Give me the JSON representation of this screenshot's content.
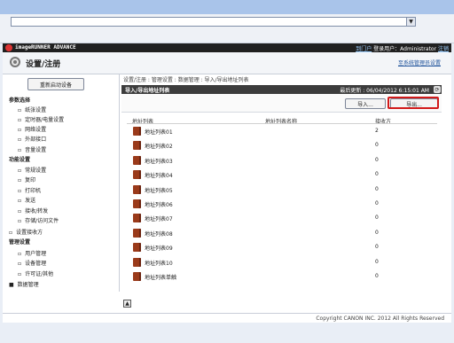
{
  "app": {
    "title": "imageRUNNER ADVANCE",
    "portal_link": "到门户",
    "login_user": "登录用户：Administrator",
    "logout_link": "注销"
  },
  "header": {
    "title": "设置/注册",
    "system_manager_link": "至系统管理员设置"
  },
  "sidebar": {
    "restart_button": "重新启动设备",
    "items": [
      {
        "label": "参数选择",
        "kind": "cat"
      },
      {
        "label": "纸张设置",
        "kind": "sub"
      },
      {
        "label": "定时器/电量设置",
        "kind": "sub"
      },
      {
        "label": "网络设置",
        "kind": "sub"
      },
      {
        "label": "外部接口",
        "kind": "sub"
      },
      {
        "label": "音量设置",
        "kind": "sub"
      },
      {
        "label": "功能设置",
        "kind": "cat"
      },
      {
        "label": "常规设置",
        "kind": "sub"
      },
      {
        "label": "复印",
        "kind": "sub"
      },
      {
        "label": "打印机",
        "kind": "sub"
      },
      {
        "label": "发送",
        "kind": "sub"
      },
      {
        "label": "接收/转发",
        "kind": "sub"
      },
      {
        "label": "存储/访问文件",
        "kind": "sub"
      },
      {
        "label": "设置接收方",
        "kind": "top"
      },
      {
        "label": "管理设置",
        "kind": "cat"
      },
      {
        "label": "用户管理",
        "kind": "sub"
      },
      {
        "label": "设备管理",
        "kind": "sub"
      },
      {
        "label": "许可证/其他",
        "kind": "sub"
      },
      {
        "label": "数据管理",
        "kind": "active"
      }
    ]
  },
  "main": {
    "breadcrumb": "设置/注册 : 管理设置 : 数据管理 : 导入/导出地址列表",
    "panel_title": "导入/导出地址列表",
    "last_updated": "最后更新 : 06/04/2012 6:15:01 AM",
    "import_button": "导入...",
    "export_button": "导出...",
    "columns": [
      "地址列表",
      "地址列表名称",
      "接收方"
    ],
    "rows": [
      {
        "name": "地址列表01",
        "count": "2"
      },
      {
        "name": "地址列表02",
        "count": "0"
      },
      {
        "name": "地址列表03",
        "count": "0"
      },
      {
        "name": "地址列表04",
        "count": "0"
      },
      {
        "name": "地址列表05",
        "count": "0"
      },
      {
        "name": "地址列表06",
        "count": "0"
      },
      {
        "name": "地址列表07",
        "count": "0"
      },
      {
        "name": "地址列表08",
        "count": "0"
      },
      {
        "name": "地址列表09",
        "count": "0"
      },
      {
        "name": "地址列表10",
        "count": "0"
      },
      {
        "name": "地址列表单触",
        "count": "0"
      }
    ]
  },
  "footer": {
    "copyright": "Copyright CANON INC. 2012 All Rights Reserved"
  }
}
